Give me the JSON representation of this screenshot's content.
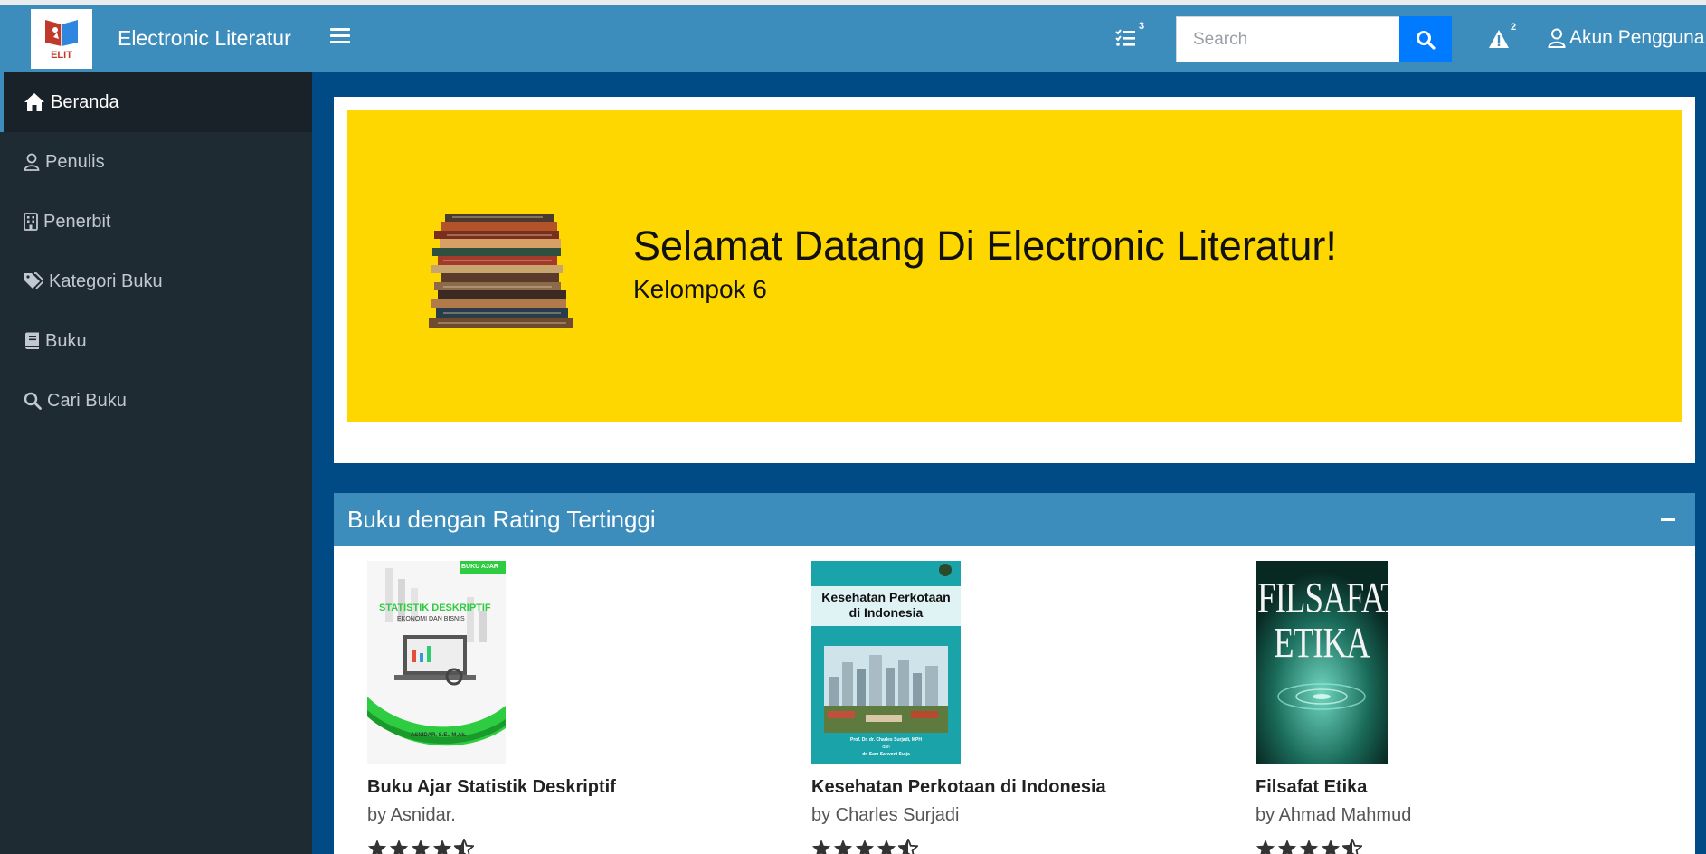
{
  "brand": {
    "logo_text": "ELIT",
    "name": "Electronic Literatur"
  },
  "navbar": {
    "menu_icon": "hamburger-icon",
    "tasks_icon": "task-list-icon",
    "tasks_badge": "3",
    "search_placeholder": "Search",
    "search_icon": "search-icon",
    "alert_icon": "warning-icon",
    "alert_badge": "2",
    "account_label": "Akun Pengguna"
  },
  "sidebar": {
    "items": [
      {
        "label": "Beranda",
        "icon": "home-icon",
        "active": true
      },
      {
        "label": "Penulis",
        "icon": "user-icon"
      },
      {
        "label": "Penerbit",
        "icon": "building-icon"
      },
      {
        "label": "Kategori Buku",
        "icon": "tags-icon"
      },
      {
        "label": "Buku",
        "icon": "book-icon"
      },
      {
        "label": "Cari Buku",
        "icon": "search-icon"
      }
    ]
  },
  "hero": {
    "title": "Selamat Datang Di Electronic Literatur!",
    "subtitle": "Kelompok 6",
    "background": "#ffd700"
  },
  "top_rated": {
    "title": "Buku dengan Rating Tertinggi",
    "books": [
      {
        "title": "Buku Ajar Statistik Deskriptif",
        "author": "by Asnidar.",
        "rating": 4.5,
        "cover_tag": "BUKU AJAR",
        "cover_title": "STATISTIK DESKRIPTIF",
        "cover_subtitle": "EKONOMI DAN BISNIS",
        "cover_author": "ASNIDAR, S.E., M.Ak."
      },
      {
        "title": "Kesehatan Perkotaan di Indonesia",
        "author": "by Charles Surjadi",
        "rating": 4.5,
        "cover_title_line1": "Kesehatan Perkotaan",
        "cover_title_line2": "di Indonesia",
        "cover_author_line1": "Prof. Dr. dr. Charles Surjadi, MPH",
        "cover_author_line2": "dan",
        "cover_author_line3": "dr. Sam Sarwoni Sutja"
      },
      {
        "title": "Filsafat Etika",
        "author": "by Ahmad Mahmud",
        "rating": 4.5,
        "cover_title_line1": "FILSAFAT",
        "cover_title_line2": "ETIKA"
      }
    ]
  },
  "colors": {
    "primary": "#3c8dbc",
    "page_bg": "#004a85",
    "sidebar_bg": "#1f2b33",
    "search_button": "#007bff"
  }
}
